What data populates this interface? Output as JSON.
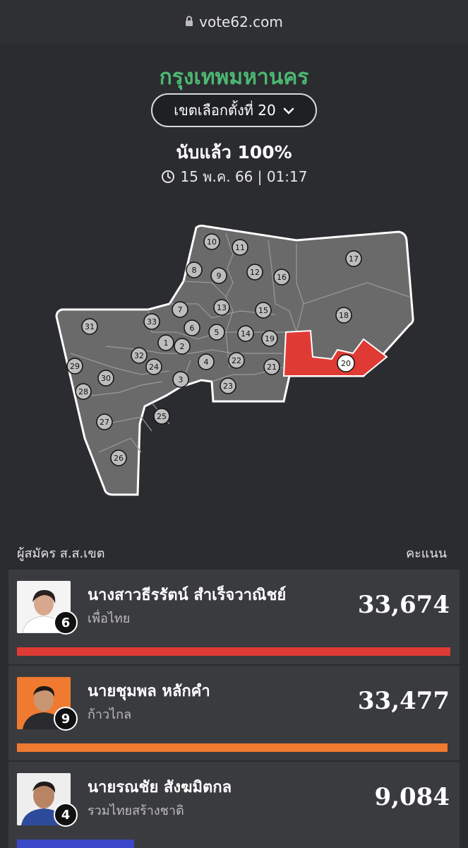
{
  "browser": {
    "url": "vote62.com"
  },
  "header": {
    "province": "กรุงเทพมหานคร",
    "district_select": "เขตเลือกตั้งที่ 20",
    "counted": "นับแล้ว 100%",
    "updated": "15 พ.ค. 66 | 01:17"
  },
  "map": {
    "highlight_color": "#e03a35",
    "base_color": "#6b6a6b",
    "selected_district": "20",
    "district_numbers": [
      "1",
      "2",
      "3",
      "4",
      "5",
      "6",
      "7",
      "8",
      "9",
      "10",
      "11",
      "12",
      "13",
      "14",
      "15",
      "16",
      "17",
      "18",
      "19",
      "20",
      "21",
      "22",
      "23",
      "24",
      "25",
      "26",
      "27",
      "28",
      "29",
      "30",
      "31",
      "32",
      "33"
    ]
  },
  "list": {
    "candidates_label": "ผู้สมัคร ส.ส.เขต",
    "score_label": "คะแนน",
    "candidates": [
      {
        "name": "นางสาวธีรรัตน์ สำเร็จวาณิชย์",
        "party": "เพื่อไทย",
        "number": "6",
        "votes": "33,674",
        "share": 1.0,
        "color": "#e03a35",
        "photo_bg": "#f4f4f4"
      },
      {
        "name": "นายชุมพล หลักคำ",
        "party": "ก้าวไกล",
        "number": "9",
        "votes": "33,477",
        "share": 0.994,
        "color": "#f07a30",
        "photo_bg": "#f07a30"
      },
      {
        "name": "นายรณชัย สังฆมิตกล",
        "party": "รวมไทยสร้างชาติ",
        "number": "4",
        "votes": "9,084",
        "share": 0.27,
        "color": "#3a47c8",
        "photo_bg": "#eeeeee"
      }
    ]
  }
}
